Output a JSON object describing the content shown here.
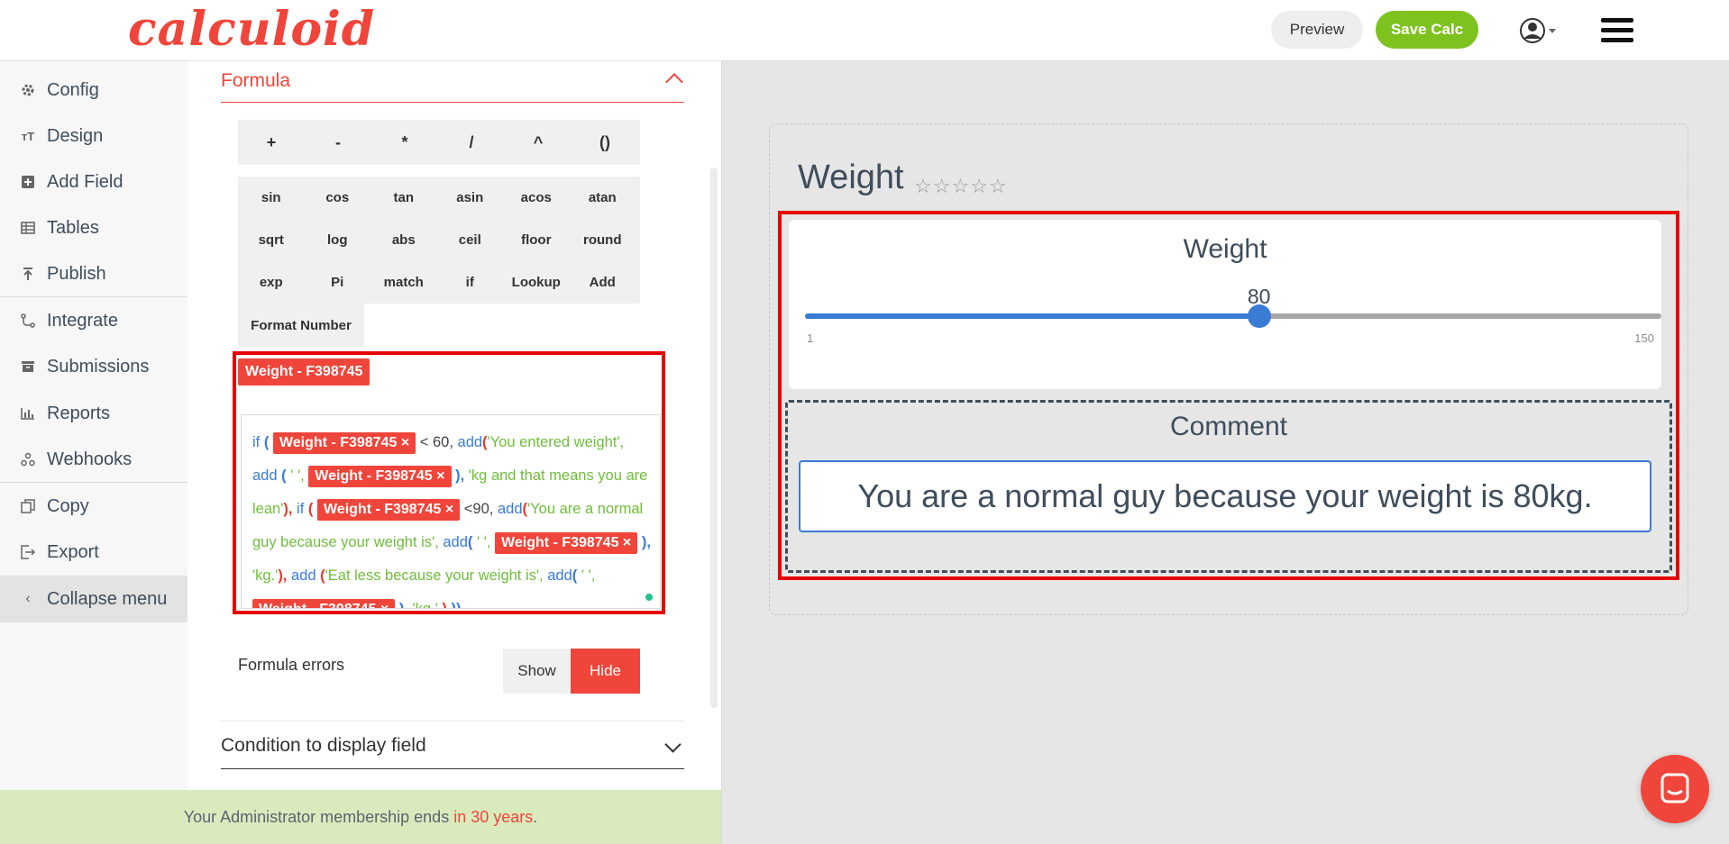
{
  "header": {
    "logo": "calculoid",
    "preview_label": "Preview",
    "save_label": "Save Calc"
  },
  "sidebar": {
    "items": [
      {
        "label": "Config",
        "icon": "gear-icon"
      },
      {
        "label": "Design",
        "icon": "text-icon"
      },
      {
        "label": "Add Field",
        "icon": "plus-square-icon"
      },
      {
        "label": "Tables",
        "icon": "table-icon"
      },
      {
        "label": "Publish",
        "icon": "upload-icon"
      },
      {
        "label": "Integrate",
        "icon": "integrate-icon"
      },
      {
        "label": "Submissions",
        "icon": "inbox-icon"
      },
      {
        "label": "Reports",
        "icon": "bar-chart-icon"
      },
      {
        "label": "Webhooks",
        "icon": "webhooks-icon"
      },
      {
        "label": "Copy",
        "icon": "copy-icon"
      },
      {
        "label": "Export",
        "icon": "export-icon"
      },
      {
        "label": "Collapse menu",
        "icon": "chevron-left-icon"
      }
    ]
  },
  "editor": {
    "formula_title": "Formula",
    "operators": [
      "+",
      "-",
      "*",
      "/",
      "^",
      "()"
    ],
    "functions_row1": [
      "sin",
      "cos",
      "tan",
      "asin",
      "acos",
      "atan"
    ],
    "functions_row2": [
      "sqrt",
      "log",
      "abs",
      "ceil",
      "floor",
      "round"
    ],
    "functions_row3": [
      "exp",
      "Pi",
      "match",
      "if",
      "Lookup",
      "Add"
    ],
    "functions_row4": [
      "Format Number"
    ],
    "source_tag": "Weight - F398745",
    "formula": {
      "tag": "Weight - F398745",
      "t_if1": "if",
      "t_paren1": "(",
      "t_lt60": "< 60,",
      "t_add1": "add",
      "t_paren2": "(",
      "t_str1": "'You entered weight',",
      "t_add2": "add",
      "t_paren3": "(",
      "t_str2": "' ',",
      "t_close1": "),",
      "t_str3": "'kg and that means you are lean'",
      "t_close2": "),",
      "t_if2": "if",
      "t_paren4": "(",
      "t_lt90": "<90,",
      "t_add3": "add",
      "t_paren5": "(",
      "t_str4": "'You are a normal guy because your weight is',",
      "t_add4": "add",
      "t_paren6": "(",
      "t_str5": "' ',",
      "t_close3": "),",
      "t_str6": "'kg.'",
      "t_close4": "),",
      "t_add5": "add",
      "t_paren7": "(",
      "t_str7": "'Eat less because your weight is',",
      "t_add6": "add",
      "t_paren8": "(",
      "t_str8": "' ',",
      "t_close5": "),",
      "t_str9": "'kg.'",
      "t_close6": ")",
      "t_close7": "))"
    },
    "errors_label": "Formula errors",
    "show_label": "Show",
    "hide_label": "Hide",
    "condition_title": "Condition to display field"
  },
  "banner": {
    "prefix": "Your Administrator membership ends ",
    "highlight": "in 30 years",
    "suffix": "."
  },
  "calc": {
    "title": "Weight",
    "stars": "☆☆☆☆☆",
    "rating": 0,
    "slider": {
      "label": "Weight",
      "value": 80,
      "value_text": "80",
      "min": 1,
      "min_text": "1",
      "max": 150,
      "max_text": "150"
    },
    "comment": {
      "label": "Comment",
      "value": "You are a normal guy because your weight is 80kg."
    }
  },
  "colors": {
    "brand_red": "#f0453a",
    "save_green": "#7dc21e",
    "slider_blue": "#3a7bd5",
    "banner_green": "#d9ebbd"
  }
}
